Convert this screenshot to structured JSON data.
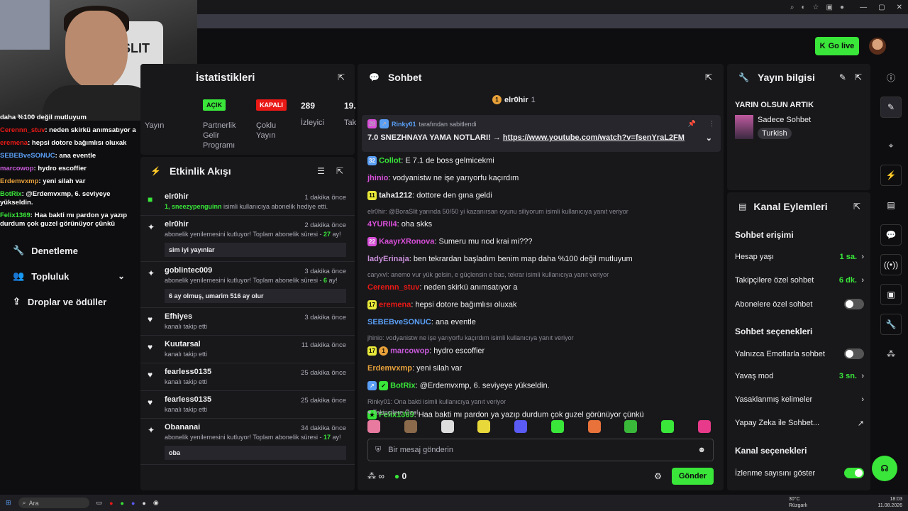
{
  "header": {
    "go_live_label": "Go live"
  },
  "overlay_chat": [
    {
      "user": "daha %100 değil mutluyum",
      "text": ""
    },
    {
      "user": "Cerennn_stuv",
      "text": ": neden skirkü anımsatıyor a"
    },
    {
      "user": "eremena",
      "text": ": hepsi dotore bağımlısı oluxak"
    },
    {
      "user": "SEBEBveSONUC",
      "text": ": ana eventle"
    },
    {
      "user": "marcowop",
      "text": ": hydro escoffier"
    },
    {
      "user": "Erdemvxmp",
      "text": ": yeni silah var"
    },
    {
      "user": "BotRix",
      "text": ": @Erdemvxmp, 6. seviyeye yükseldin."
    },
    {
      "user": "Felix1369",
      "text": ": Haa bakti mı pardon ya yazıp durdum çok guzel görünüyor çünkü"
    }
  ],
  "sidenav": {
    "items": [
      {
        "label": "Denetleme"
      },
      {
        "label": "Topluluk"
      },
      {
        "label": "Droplar ve ödüller"
      }
    ]
  },
  "stats": {
    "title": "İstatistikleri",
    "left_label": "Yayın",
    "acik": "AÇIK",
    "kapali": "KAPALI",
    "partner_label": "Partnerlik Gelir Programı",
    "multi_label": "Çoklu Yayın",
    "viewers_num": "289",
    "viewers_label": "İzleyici",
    "extra_num": "19.",
    "extra_label": "Tak"
  },
  "activity": {
    "title": "Etkinlik Akışı",
    "events": [
      {
        "name": "elr0hir",
        "time": "1 dakika önce",
        "desc_pre": "",
        "highlight": "1, sneezypenguinn",
        "desc_post": " isimli kullanıcıya abonelik hediye etti.",
        "msg": ""
      },
      {
        "name": "elr0hir",
        "time": "2 dakika önce",
        "desc_pre": "abonelik yenilemesini kutluyor! Toplam abonelik süresi - ",
        "highlight": "27",
        "desc_post": " ay!",
        "msg": "sim iyi yayınlar"
      },
      {
        "name": "goblintec009",
        "time": "3 dakika önce",
        "desc_pre": "abonelik yenilemesini kutluyor! Toplam abonelik süresi - ",
        "highlight": "6",
        "desc_post": " ay!",
        "msg": "6 ay olmuş, umarim 516 ay olur"
      },
      {
        "name": "Efhiyes",
        "time": "3 dakika önce",
        "desc_pre": "kanalı takip etti",
        "highlight": "",
        "desc_post": "",
        "msg": ""
      },
      {
        "name": "Kuutarsal",
        "time": "11 dakika önce",
        "desc_pre": "kanalı takip etti",
        "highlight": "",
        "desc_post": "",
        "msg": ""
      },
      {
        "name": "fearless0135",
        "time": "25 dakika önce",
        "desc_pre": "kanalı takip etti",
        "highlight": "",
        "desc_post": "",
        "msg": ""
      },
      {
        "name": "fearless0135",
        "time": "25 dakika önce",
        "desc_pre": "kanalı takip etti",
        "highlight": "",
        "desc_post": "",
        "msg": ""
      },
      {
        "name": "Obananai",
        "time": "34 dakika önce",
        "desc_pre": "abonelik yenilemesini kutluyor! Toplam abonelik süresi - ",
        "highlight": "17",
        "desc_post": " ay!",
        "msg": "oba"
      }
    ]
  },
  "chat": {
    "title": "Sohbet",
    "pinned_user": "elr0hir",
    "pinned_count": "1",
    "pin_by_user": "Rinky01",
    "pin_by_text": "tarafından sabitlendi",
    "pin_message": "7.0 SNEZHNAYA YAMA NOTLARI! → ",
    "pin_link": "https://www.youtube.com/watch?v=fsenYraL2FM",
    "messages": [
      {
        "reply": "",
        "user": "Collot",
        "color": "#39e639",
        "text": ": E 7.1 de boss gelmicekmi"
      },
      {
        "reply": "",
        "user": "jhinio",
        "color": "#d94fd9",
        "text": ": vodyanistw ne işe yarıyorfu kaçırdım"
      },
      {
        "reply": "",
        "user": "taha1212",
        "color": "#efeff1",
        "text": ": dottore den gına geldi"
      },
      {
        "reply": "elr0hir: @BoraSlit yarında 50/50 yi kazanırsan oyunu siliyorum isimli kullanıcıya yanıt veriyor",
        "user": "4YURII4",
        "color": "#d94fd9",
        "text": ": oha skks"
      },
      {
        "reply": "",
        "user": "KaayrXRonova",
        "color": "#d94fd9",
        "text": ": Sumeru mu nod krai mi???"
      },
      {
        "reply": "",
        "user": "ladyErinaja",
        "color": "#c98fd9",
        "text": ": ben tekrardan başladım benim map daha %100 değil mutluyum"
      },
      {
        "reply": "caryxvl: anemo vur yük gelsin, e güçlensin e bas, tekrar isimli kullanıcıya yanıt veriyor",
        "user": "Cerennn_stuv",
        "color": "#e91916",
        "text": ": neden skirkü anımsatıyor a"
      },
      {
        "reply": "",
        "user": "eremena",
        "color": "#e91916",
        "text": ": hepsi dotore bağımlısı oluxak"
      },
      {
        "reply": "",
        "user": "SEBEBveSONUC",
        "color": "#5a9ff5",
        "text": ": ana eventle"
      },
      {
        "reply": "jhinio: vodyanistw ne işe yarıyorfu kaçırdım isimli kullanıcıya yanıt veriyor",
        "user": "marcowop",
        "color": "#c85ad9",
        "text": ": hydro escoffier"
      },
      {
        "reply": "",
        "user": "Erdemvxmp",
        "color": "#e8a13a",
        "text": ": yeni silah var"
      },
      {
        "reply": "",
        "user": "BotRix",
        "color": "#39e639",
        "text": ": @Erdemvxmp, 6. seviyeye yükseldin."
      },
      {
        "reply": "Rinky01: Ona bakti isimli kullanıcıya yanıt veriyor",
        "user": "Felix1369",
        "color": "#39e639",
        "text": ": Haa bakti mı pardon ya yazıp durdum çok guzel görünüyor çünkü"
      }
    ],
    "emote_label": "Takipçilere Özel",
    "input_placeholder": "Bir mesaj gönderin",
    "infinity": "∞",
    "points": "0",
    "send_label": "Gönder"
  },
  "info": {
    "title": "Yayın bilgisi",
    "stream_title": "YARIN OLSUN ARTIK",
    "category": "Sadece Sohbet",
    "language": "Turkish"
  },
  "channel_actions": {
    "title": "Kanal Eylemleri",
    "chat_access": "Sohbet erişimi",
    "account_age": "Hesap yaşı",
    "account_age_val": "1 sa.",
    "followers_only": "Takipçilere özel sohbet",
    "followers_only_val": "6 dk.",
    "subs_only": "Abonelere özel sohbet",
    "chat_options": "Sohbet seçenekleri",
    "emotes_only": "Yalnızca Emotlarla sohbet",
    "slow_mode": "Yavaş mod",
    "slow_mode_val": "3 sn.",
    "banned_words": "Yasaklanmış kelimeler",
    "ai_chat": "Yapay Zeka ile Sohbet...",
    "channel_options": "Kanal seçenekleri",
    "show_viewers": "İzlenme sayısını göster"
  },
  "taskbar": {
    "search": "Ara",
    "weather_temp": "30°C",
    "weather_desc": "Rüzgarlı",
    "time": "18:03",
    "date": "11.08.2026"
  }
}
